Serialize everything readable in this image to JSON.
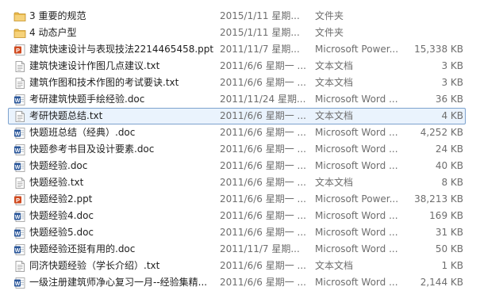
{
  "files": [
    {
      "name": "3 重要的规范",
      "date": "2015/1/11 星期...",
      "type": "文件夹",
      "size": "",
      "icon": "folder-icon"
    },
    {
      "name": "4 动态户型",
      "date": "2015/1/11 星期...",
      "type": "文件夹",
      "size": "",
      "icon": "folder-icon"
    },
    {
      "name": "建筑快速设计与表现技法2214465458.ppt",
      "date": "2011/11/7 星期...",
      "type": "Microsoft Power...",
      "size": "15,338 KB",
      "icon": "ppt-icon"
    },
    {
      "name": "建筑快速设计作图几点建议.txt",
      "date": "2011/6/6 星期一 ...",
      "type": "文本文档",
      "size": "3 KB",
      "icon": "txt-icon"
    },
    {
      "name": "建筑作图和技术作图的考试要诀.txt",
      "date": "2011/6/6 星期一 ...",
      "type": "文本文档",
      "size": "3 KB",
      "icon": "txt-icon"
    },
    {
      "name": "考研建筑快题手绘经验.doc",
      "date": "2011/11/24 星期...",
      "type": "Microsoft Word ...",
      "size": "36 KB",
      "icon": "doc-icon"
    },
    {
      "name": "考研快题总结.txt",
      "date": "2011/6/6 星期一 ...",
      "type": "文本文档",
      "size": "4 KB",
      "icon": "txt-icon",
      "selected": true
    },
    {
      "name": "快题班总结（经典）.doc",
      "date": "2011/6/6 星期一 ...",
      "type": "Microsoft Word ...",
      "size": "4,252 KB",
      "icon": "doc-icon"
    },
    {
      "name": "快题参考书目及设计要素.doc",
      "date": "2011/6/6 星期一 ...",
      "type": "Microsoft Word ...",
      "size": "24 KB",
      "icon": "doc-icon"
    },
    {
      "name": "快题经验.doc",
      "date": "2011/6/6 星期一 ...",
      "type": "Microsoft Word ...",
      "size": "40 KB",
      "icon": "doc-icon"
    },
    {
      "name": "快题经验.txt",
      "date": "2011/6/6 星期一 ...",
      "type": "文本文档",
      "size": "8 KB",
      "icon": "txt-icon"
    },
    {
      "name": "快题经验2.ppt",
      "date": "2011/6/6 星期一 ...",
      "type": "Microsoft Power...",
      "size": "38,213 KB",
      "icon": "ppt-icon"
    },
    {
      "name": "快题经验4.doc",
      "date": "2011/6/6 星期一 ...",
      "type": "Microsoft Word ...",
      "size": "169 KB",
      "icon": "doc-icon"
    },
    {
      "name": "快题经验5.doc",
      "date": "2011/6/6 星期一 ...",
      "type": "Microsoft Word ...",
      "size": "31 KB",
      "icon": "doc-icon"
    },
    {
      "name": "快题经验还挺有用的.doc",
      "date": "2011/11/7 星期...",
      "type": "Microsoft Word ...",
      "size": "50 KB",
      "icon": "doc-icon"
    },
    {
      "name": "同济快题经验（学长介绍）.txt",
      "date": "2011/6/6 星期一 ...",
      "type": "文本文档",
      "size": "1 KB",
      "icon": "txt-icon"
    },
    {
      "name": "一级注册建筑师净心复习一月--经验集精...",
      "date": "2011/6/6 星期一 ...",
      "type": "Microsoft Word ...",
      "size": "2,144 KB",
      "icon": "doc-icon"
    }
  ],
  "colors": {
    "selection_border": "#7da2ce",
    "selection_fill": "#eaf3fd",
    "folder": "#e8b84a",
    "ppt": "#d04a1f",
    "doc": "#2b579a"
  }
}
